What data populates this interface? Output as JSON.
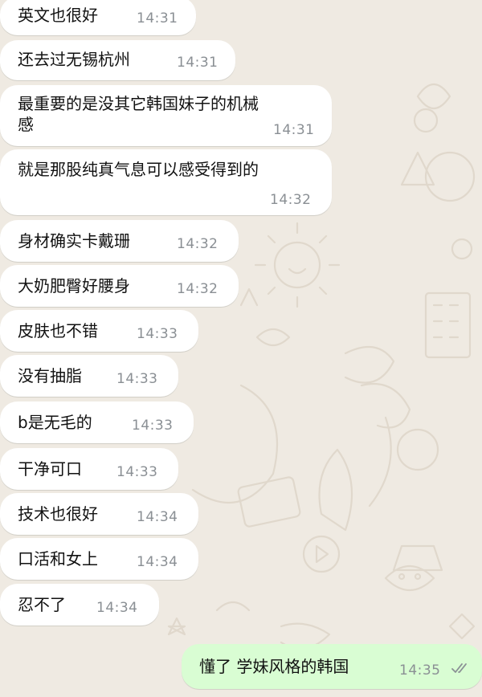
{
  "chat": {
    "incoming": [
      {
        "text": "英文也很好",
        "time": "14:31"
      },
      {
        "text": "还去过无锡杭州",
        "time": "14:31"
      },
      {
        "text_line1": "最重要的是没其它韩国妹子的机械",
        "text_line2": "感",
        "time": "14:31"
      },
      {
        "text": "就是那股纯真气息可以感受得到的",
        "time": "14:32"
      },
      {
        "text": "身材确实卡戴珊",
        "time": "14:32"
      },
      {
        "text": "大奶肥臀好腰身",
        "time": "14:32"
      },
      {
        "text": "皮肤也不错",
        "time": "14:33"
      },
      {
        "text": "没有抽脂",
        "time": "14:33"
      },
      {
        "text": "b是无毛的",
        "time": "14:33"
      },
      {
        "text": "干净可口",
        "time": "14:33"
      },
      {
        "text": "技术也很好",
        "time": "14:34"
      },
      {
        "text": "口活和女上",
        "time": "14:34"
      },
      {
        "text": "忍不了",
        "time": "14:34"
      }
    ],
    "outgoing": [
      {
        "text": "懂了 学妹风格的韩国",
        "time": "14:35",
        "status_icon": "double-check-icon"
      }
    ]
  },
  "colors": {
    "wallpaper": "#efeae2",
    "incoming_bubble": "#ffffff",
    "outgoing_bubble": "#d9fdd3",
    "timestamp": "#8a8f94"
  }
}
